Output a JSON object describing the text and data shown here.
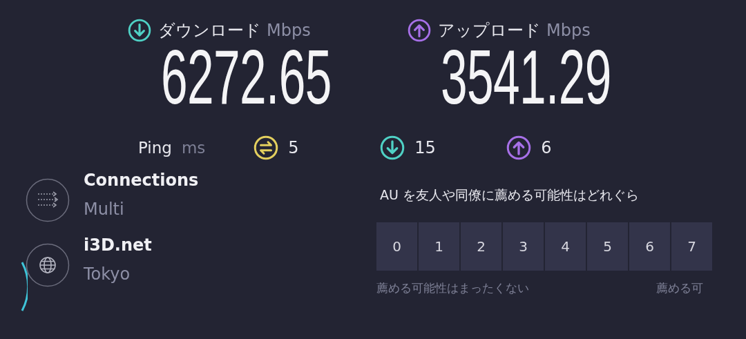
{
  "results": [
    {
      "kind": "download",
      "label": "ダウンロード",
      "unit": "Mbps",
      "value": "6272.65"
    },
    {
      "kind": "upload",
      "label": "アップロード",
      "unit": "Mbps",
      "value": "3541.29"
    }
  ],
  "ping": {
    "label": "Ping",
    "unit": "ms",
    "items": [
      {
        "kind": "idle",
        "value": "5"
      },
      {
        "kind": "download",
        "value": "15"
      },
      {
        "kind": "upload",
        "value": "6"
      }
    ]
  },
  "info": [
    {
      "kind": "connections",
      "title": "Connections",
      "subtitle": "Multi"
    },
    {
      "kind": "server",
      "title": "i3D.net",
      "subtitle": "Tokyo"
    }
  ],
  "survey": {
    "question": "AU を友人や同僚に薦める可能性はどれぐら",
    "scale": [
      "0",
      "1",
      "2",
      "3",
      "4",
      "5",
      "6",
      "7"
    ],
    "low_label": "薦める可能性はまったくない",
    "high_label": "薦める可"
  }
}
